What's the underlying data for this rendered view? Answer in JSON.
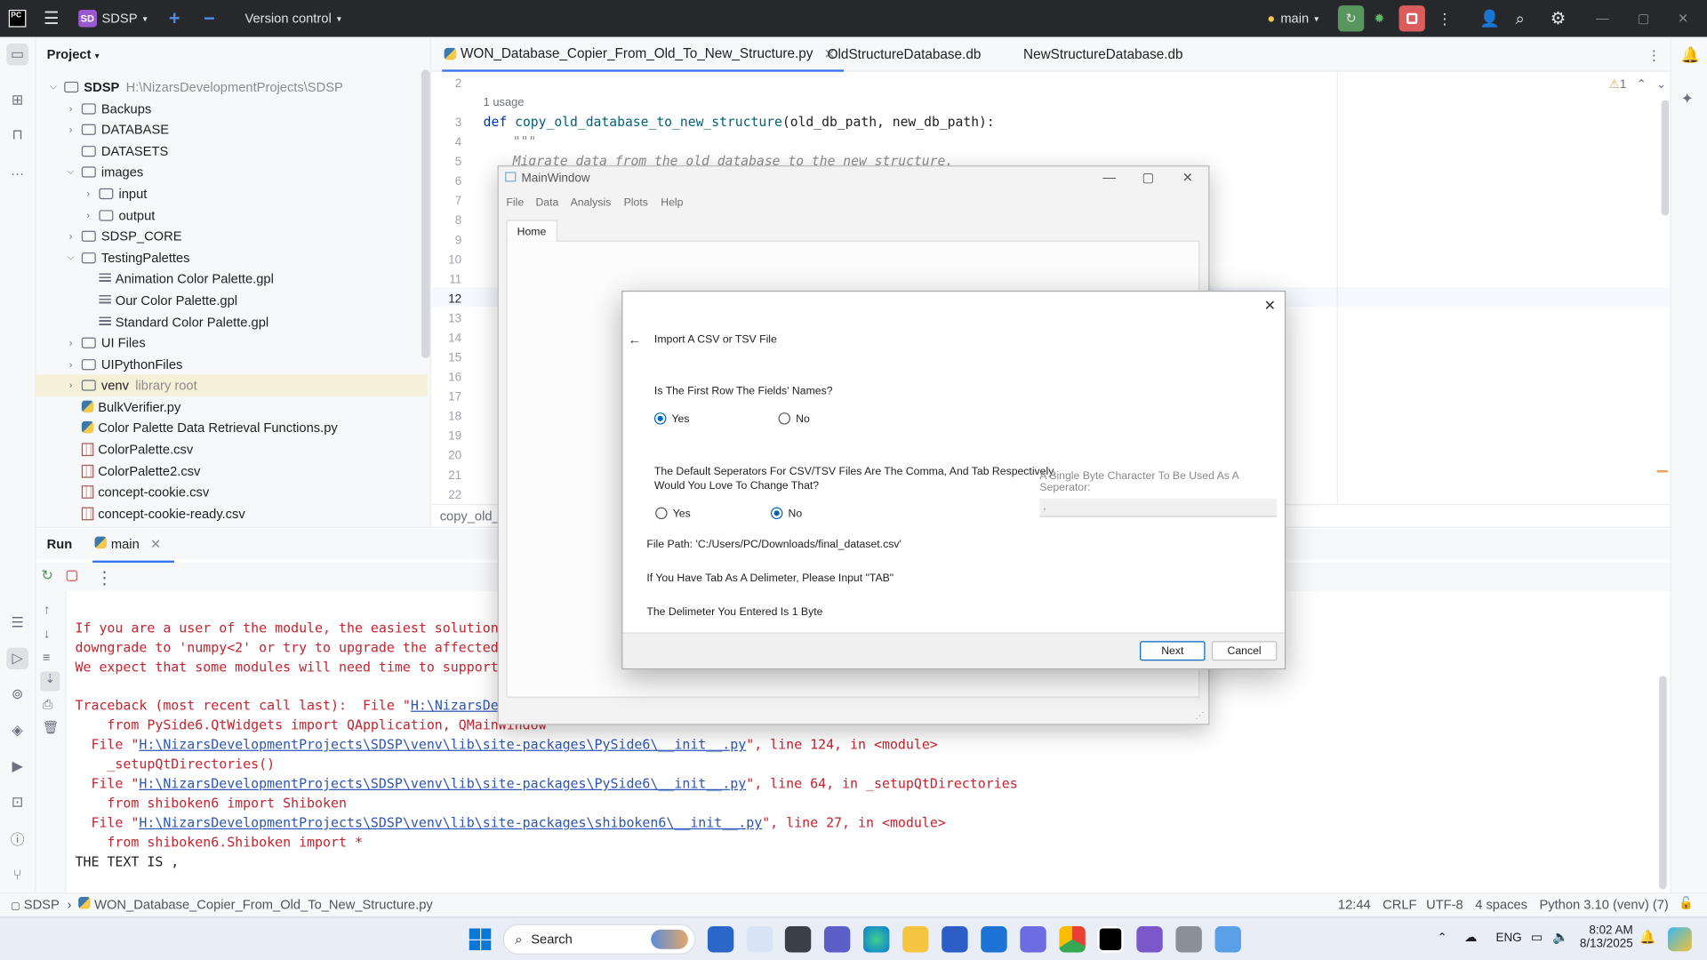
{
  "titlebar": {
    "app_badge": "SD",
    "project": "SDSP",
    "vcs": "Version control",
    "branch": "main"
  },
  "project_panel": {
    "title": "Project",
    "root": {
      "name": "SDSP",
      "path": "H:\\NizarsDevelopmentProjects\\SDSP"
    },
    "items": [
      {
        "label": "Backups"
      },
      {
        "label": "DATABASE"
      },
      {
        "label": "DATASETS"
      },
      {
        "label": "images"
      },
      {
        "label": "input"
      },
      {
        "label": "output"
      },
      {
        "label": "SDSP_CORE"
      },
      {
        "label": "TestingPalettes"
      },
      {
        "label": "Animation Color Palette.gpl"
      },
      {
        "label": "Our Color Palette.gpl"
      },
      {
        "label": "Standard Color Palette.gpl"
      },
      {
        "label": "UI Files"
      },
      {
        "label": "UIPythonFiles"
      },
      {
        "label": "venv",
        "note": "library root"
      },
      {
        "label": "BulkVerifier.py"
      },
      {
        "label": "Color Palette Data Retrieval Functions.py"
      },
      {
        "label": "ColorPalette.csv"
      },
      {
        "label": "ColorPalette2.csv"
      },
      {
        "label": "concept-cookie.csv"
      },
      {
        "label": "concept-cookie-ready.csv"
      }
    ]
  },
  "editor": {
    "tabs": [
      "WON_Database_Copier_From_Old_To_New_Structure.py",
      "OldStructureDatabase.db",
      "NewStructureDatabase.db"
    ],
    "usage": "1 usage",
    "def_kw": "def",
    "func_name": "copy_old_database_to_new_structure",
    "params": "(old_db_path, new_db_path):",
    "docstring_open": "\"\"\"",
    "docstring_text": "Migrate data from the old database to the new structure.",
    "line_numbers": [
      "2",
      "3",
      "4",
      "5",
      "6",
      "7",
      "8",
      "9",
      "10",
      "11",
      "12",
      "13",
      "14",
      "15",
      "16",
      "17",
      "18",
      "19",
      "20",
      "21",
      "22"
    ],
    "warning_count": "1",
    "breadcrumb": "copy_old_d"
  },
  "run": {
    "tab_run": "Run",
    "tab_main": "main",
    "console": [
      "If you are a user of the module, the easiest solution will b",
      "downgrade to 'numpy<2' or try to upgrade the affected module",
      "We expect that some modules will need time to support NumPy",
      "",
      "Traceback (most recent call last):  File \"",
      "    from PySide6.QtWidgets import QApplication, QMainWindow",
      "  File \"",
      "    _setupQtDirectories()",
      "  File \"",
      "    from shiboken6 import Shiboken",
      "  File \"",
      "    from shiboken6.Shiboken import *",
      "THE TEXT IS ,"
    ],
    "links": {
      "l4": "H:\\NizarsDevelopm",
      "l6": "H:\\NizarsDevelopmentProjects\\SDSP\\venv\\lib\\site-packages\\PySide6\\__init__.py",
      "l8": "H:\\NizarsDevelopmentProjects\\SDSP\\venv\\lib\\site-packages\\PySide6\\__init__.py",
      "l10": "H:\\NizarsDevelopmentProjects\\SDSP\\venv\\lib\\site-packages\\shiboken6\\__init__.py"
    },
    "tails": {
      "l6": "\", line 124, in <module>",
      "l8": "\", line 64, in _setupQtDirectories",
      "l10": "\", line 27, in <module>"
    }
  },
  "main_window": {
    "title": "MainWindow",
    "menu": [
      "File",
      "Data",
      "Analysis",
      "Plots",
      "Help"
    ],
    "tab": "Home"
  },
  "dialog": {
    "title": "Import A CSV or TSV File",
    "q1": "Is The First Row The Fields' Names?",
    "q1_yes": "Yes",
    "q1_no": "No",
    "q1_selected": "Yes",
    "q2_line1": "The Default Seperators For CSV/TSV Files Are The Comma, And Tab Respectively.",
    "q2_line2": "Would You Love To Change That?",
    "q2_yes": "Yes",
    "q2_no": "No",
    "q2_selected": "No",
    "sep_label": "A Single Byte Character To Be Used As A Seperator:",
    "sep_value": ",",
    "file_path": "File Path: 'C:/Users/PC/Downloads/final_dataset.csv'",
    "tab_hint": "If You Have Tab As A Delimeter, Please Input \"TAB\"",
    "delim_info": "The Delimeter You Entered Is 1 Byte",
    "next": "Next",
    "cancel": "Cancel"
  },
  "statusbar": {
    "crumb_root": "SDSP",
    "crumb_file": "WON_Database_Copier_From_Old_To_New_Structure.py",
    "position": "12:44",
    "line_sep": "CRLF",
    "encoding": "UTF-8",
    "indent": "4 spaces",
    "interpreter": "Python 3.10 (venv) (7)"
  },
  "taskbar": {
    "search": "Search",
    "lang": "ENG",
    "time": "8:02 AM",
    "date": "8/13/2025"
  }
}
